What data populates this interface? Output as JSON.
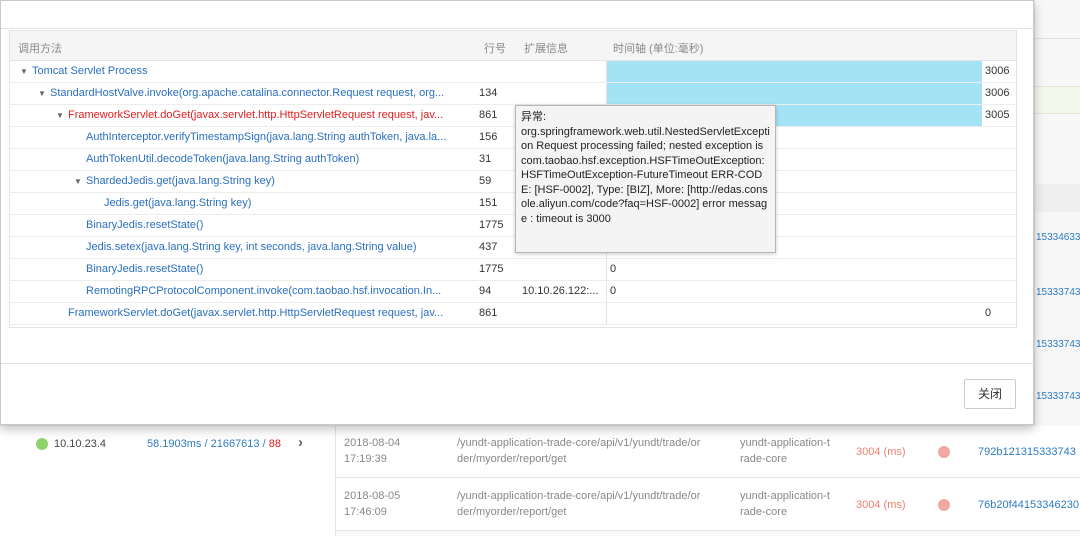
{
  "background": {
    "right_ids": [
      "15334633",
      "15333743",
      "15333743",
      "15333743"
    ],
    "rows": [
      {
        "date": "2018-08-04",
        "time": "17:19:39",
        "path": "/yundt-application-trade-core/api/v1/yundt/trade/or",
        "path2": "der/myorder/report/get",
        "app": "yundt-application-t",
        "app2": "rade-core",
        "duration": "3004 (ms)",
        "id": "792b121315333743"
      },
      {
        "date": "2018-08-05",
        "time": "17:46:09",
        "path": "/yundt-application-trade-core/api/v1/yundt/trade/or",
        "path2": "der/myorder/report/get",
        "app": "yundt-application-t",
        "app2": "rade-core",
        "duration": "3004 (ms)",
        "id": "76b20f44153346230"
      }
    ],
    "host": {
      "ip": "10.10.23.4",
      "stats_prefix": "58.1903ms / 21667613 / ",
      "stats_err": "88",
      "arrow": "›"
    }
  },
  "grid": {
    "headers": {
      "method": "调用方法",
      "line": "行号",
      "ext": "扩展信息",
      "timeline": "时间轴 (单位:毫秒)"
    },
    "rows": [
      {
        "indent": 0,
        "toggle": "▼",
        "method": "Tomcat Servlet Process",
        "line": "",
        "ext": "",
        "bar": 1.0,
        "value": "3006",
        "error": false
      },
      {
        "indent": 1,
        "toggle": "▼",
        "method": "StandardHostValve.invoke(org.apache.catalina.connector.Request request, org...",
        "line": "134",
        "ext": "",
        "bar": 1.0,
        "value": "3006",
        "error": false
      },
      {
        "indent": 2,
        "toggle": "▼",
        "method": "FrameworkServlet.doGet(javax.servlet.http.HttpServletRequest request, jav...",
        "line": "861",
        "ext": "",
        "bar": 1.0,
        "value": "3005",
        "error": true
      },
      {
        "indent": 3,
        "toggle": "",
        "method": "AuthInterceptor.verifyTimestampSign(java.lang.String authToken, java.la...",
        "line": "156",
        "ext": "",
        "bar": 0,
        "value": "",
        "error": false
      },
      {
        "indent": 3,
        "toggle": "",
        "method": "AuthTokenUtil.decodeToken(java.lang.String authToken)",
        "line": "31",
        "ext": "",
        "bar": 0,
        "value": "",
        "error": false
      },
      {
        "indent": 3,
        "toggle": "▼",
        "method": "ShardedJedis.get(java.lang.String key)",
        "line": "59",
        "ext": "",
        "bar": 0,
        "value": "",
        "error": false
      },
      {
        "indent": 4,
        "toggle": "",
        "method": "Jedis.get(java.lang.String key)",
        "line": "151",
        "ext": "",
        "bar": 0,
        "value": "",
        "error": false
      },
      {
        "indent": 3,
        "toggle": "",
        "method": "BinaryJedis.resetState()",
        "line": "1775",
        "ext": "",
        "bar": 0,
        "value": "",
        "error": false
      },
      {
        "indent": 3,
        "toggle": "",
        "method": "Jedis.setex(java.lang.String key, int seconds, java.lang.String value)",
        "line": "437",
        "ext": "",
        "bar": 0,
        "value": "",
        "error": false
      },
      {
        "indent": 3,
        "toggle": "",
        "method": "BinaryJedis.resetState()",
        "line": "1775",
        "ext": "",
        "bar": 0,
        "value": "0",
        "error": false
      },
      {
        "indent": 3,
        "toggle": "",
        "method": "RemotingRPCProtocolComponent.invoke(com.taobao.hsf.invocation.In...",
        "line": "94",
        "ext": "10.10.26.122:...",
        "bar": 0,
        "value": "0",
        "error": false
      },
      {
        "indent": 2,
        "toggle": "",
        "method": "FrameworkServlet.doGet(javax.servlet.http.HttpServletRequest request, jav...",
        "line": "861",
        "ext": "",
        "bar": 0,
        "value": "0",
        "value_right": true,
        "error": false
      }
    ]
  },
  "tooltip": {
    "title": "异常:",
    "body": "org.springframework.web.util.NestedServletException Request processing failed; nested exception is com.taobao.hsf.exception.HSFTimeOutException: HSFTimeOutException-FutureTimeout ERR-CODE: [HSF-0002], Type: [BIZ], More: [http://edas.console.aliyun.com/code?faq=HSF-0002] error message : timeout is 3000"
  },
  "footer": {
    "close_label": "关闭"
  },
  "colors": {
    "link": "#2a6fc0",
    "error": "#e02020",
    "bar": "#a3e3f5",
    "status_green": "#8fd36a",
    "status_red": "#f0a9a0"
  }
}
